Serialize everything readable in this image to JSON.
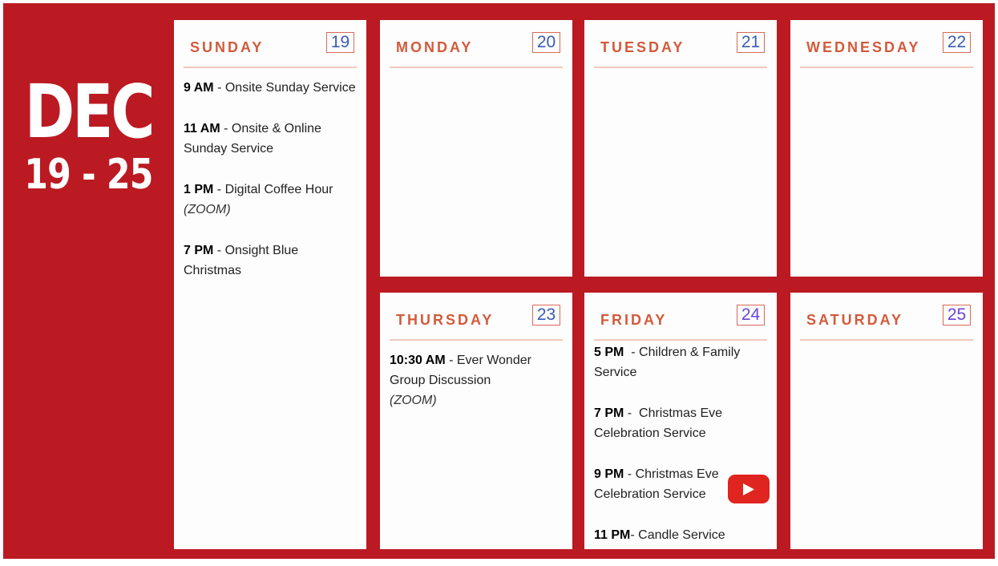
{
  "header": {
    "month": "DEC",
    "range": "19 - 25"
  },
  "days": {
    "sunday": {
      "name": "SUNDAY",
      "date": "19",
      "events": [
        {
          "time": "9 AM",
          "sep": " - ",
          "text": "Onsite Sunday Service",
          "note": ""
        },
        {
          "time": "11 AM",
          "sep": " - ",
          "text": "Onsite & Online Sunday Service",
          "note": ""
        },
        {
          "time": "1 PM",
          "sep": " - ",
          "text": "Digital Coffee Hour",
          "note": "(ZOOM)"
        },
        {
          "time": "7 PM",
          "sep": " - ",
          "text": "Onsight Blue Christmas",
          "note": ""
        }
      ]
    },
    "monday": {
      "name": "MONDAY",
      "date": "20"
    },
    "tuesday": {
      "name": "TUESDAY",
      "date": "21"
    },
    "wednesday": {
      "name": "WEDNESDAY",
      "date": "22"
    },
    "thursday": {
      "name": "THURSDAY",
      "date": "23",
      "events": [
        {
          "time": "10:30 AM",
          "sep": " - ",
          "text": "Ever Wonder Group Discussion",
          "note": "(ZOOM)"
        }
      ]
    },
    "friday": {
      "name": "FRIDAY",
      "date": "24",
      "events": [
        {
          "time": "5 PM",
          "sep": "  - ",
          "text": "Children & Family Service",
          "note": ""
        },
        {
          "time": "7 PM",
          "sep": " -  ",
          "text": "Christmas Eve Celebration Service",
          "note": ""
        },
        {
          "time": "9 PM",
          "sep": " - ",
          "text": "Christmas Eve Celebration Service",
          "note": ""
        },
        {
          "time": "11 PM",
          "sep": "- ",
          "text": "Candle Service",
          "note": ""
        }
      ]
    },
    "saturday": {
      "name": "SATURDAY",
      "date": "25"
    }
  },
  "icons": {
    "stream": "youtube-play-icon"
  },
  "colors": {
    "background": "#bb1a22",
    "card": "#fdfdfd",
    "day_name": "#d35a3b",
    "date_number": "#3a5bb8",
    "date_number_weekend": "#6a45d8",
    "youtube_red": "#e0241f"
  }
}
